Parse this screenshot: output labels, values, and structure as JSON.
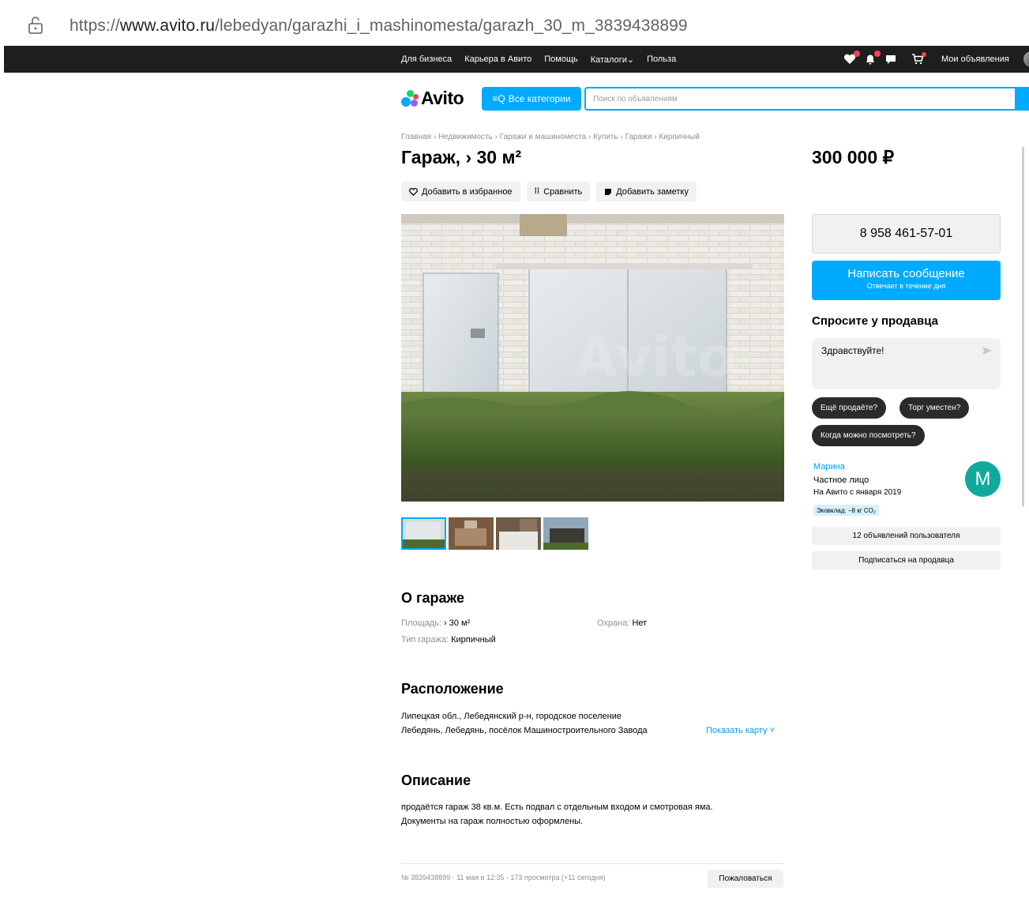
{
  "browser": {
    "url_prefix": "https://",
    "url_domain": "www.avito.ru",
    "url_path": "/lebedyan/garazhi_i_mashinomesta/garazh_30_m_3839438899"
  },
  "topnav": {
    "links": [
      "Для бизнеса",
      "Карьера в Авито",
      "Помощь",
      "Каталоги",
      "Польза"
    ],
    "my_ads": "Мои объявления"
  },
  "header": {
    "logo_text": "Avito",
    "categories_button": "Все категории",
    "search_placeholder": "Поиск по объявлениям"
  },
  "breadcrumbs": [
    "Главная",
    "Недвижимость",
    "Гаражи и машиноместа",
    "Купить",
    "Гаражи",
    "Кирпичный"
  ],
  "listing": {
    "title": "Гараж, › 30 м²",
    "price": "300 000 ₽",
    "actions": {
      "favorite": "Добавить в избранное",
      "compare": "Сравнить",
      "note": "Добавить заметку"
    },
    "watermark": "Avito"
  },
  "contact": {
    "phone": "8 958 461-57-01",
    "message_button": "Написать сообщение",
    "message_sub": "Отвечает в течение дня",
    "ask_title": "Спросите у продавца",
    "ask_text": "Здравствуйте!",
    "chips": [
      "Ещё продаёте?",
      "Торг уместен?",
      "Когда можно посмотреть?"
    ]
  },
  "seller": {
    "name": "Марина",
    "type": "Частное лицо",
    "since": "На Авито с января 2019",
    "eco": "Эковклад: −8 кг CO₂",
    "avatar_letter": "М",
    "ads_button": "12 объявлений пользователя",
    "subscribe_button": "Подписаться на продавца"
  },
  "about": {
    "title": "О гараже",
    "area_label": "Площадь: ",
    "area_value": "› 30 м²",
    "security_label": "Охрана: ",
    "security_value": "Нет",
    "type_label": "Тип гаража: ",
    "type_value": "Кирпичный"
  },
  "location": {
    "title": "Расположение",
    "line1": "Липецкая обл., Лебедянский р-н, городское поселение",
    "line2": "Лебедянь, Лебедянь, посёлок Машиностроительного Завода",
    "show_map": "Показать карту ˅"
  },
  "description": {
    "title": "Описание",
    "line1": "продаётся гараж 38 кв.м. Есть подвал с отдельным входом и смотровая яма.",
    "line2": "Документы на гараж полностью оформлены."
  },
  "footer": {
    "meta": "№ 3839438899 · 11 мая в 12:35 · 173 просмотра (+11 сегодня)",
    "report": "Пожаловаться"
  },
  "colors": {
    "accent": "#00aaff",
    "topnav_bg": "#1e1e1e",
    "button_bg": "#f2f1f0",
    "link": "#0099f7",
    "avatar": "#11a99b",
    "badge": "#ff4053"
  }
}
